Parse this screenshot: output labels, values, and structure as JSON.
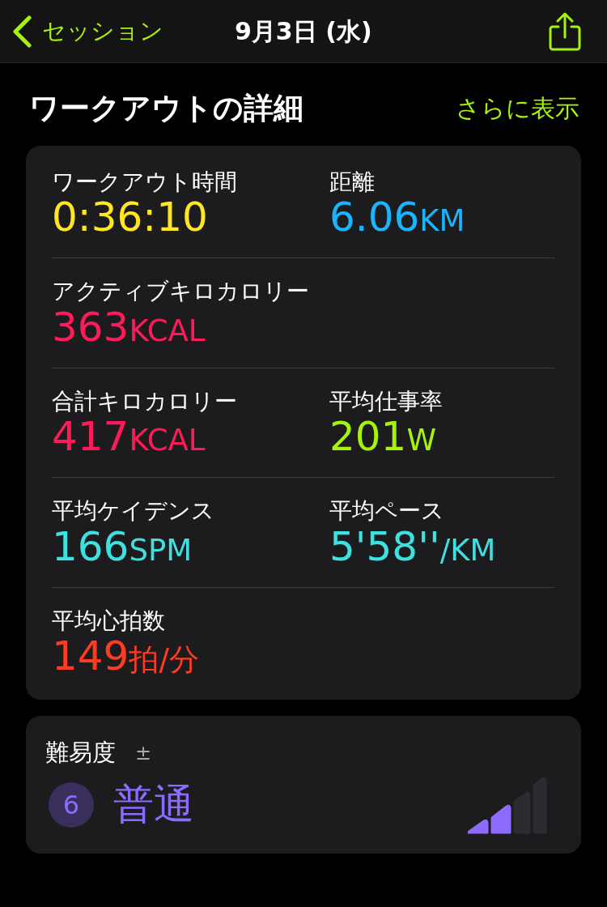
{
  "nav": {
    "back_label": "セッション",
    "title": "9月3日 (水)"
  },
  "section": {
    "title": "ワークアウトの詳細",
    "more_link": "さらに表示"
  },
  "metric_rows": [
    {
      "metrics": [
        {
          "label": "ワークアウト時間",
          "value": "0:36:10",
          "color": "#ffe620"
        },
        {
          "label": "距離",
          "value": "6.06",
          "unit": "KM",
          "color": "#1ab4ff"
        }
      ]
    },
    {
      "metrics": [
        {
          "label": "アクティブキロカロリー",
          "value": "363",
          "unit": "KCAL",
          "color": "#ff1a5a"
        }
      ]
    },
    {
      "metrics": [
        {
          "label": "合計キロカロリー",
          "value": "417",
          "unit": "KCAL",
          "color": "#ff1a5a"
        },
        {
          "label": "平均仕事率",
          "value": "201",
          "unit": "W",
          "color": "#a6f20a"
        }
      ]
    },
    {
      "metrics": [
        {
          "label": "平均ケイデンス",
          "value": "166",
          "unit": "SPM",
          "color": "#3ee0e0"
        },
        {
          "label": "平均ペース",
          "value": "5'58''",
          "unit": "/KM",
          "color": "#3ee0e0"
        }
      ]
    },
    {
      "metrics": [
        {
          "label": "平均心拍数",
          "value": "149",
          "unit": "拍/分",
          "color": "#ff3b22"
        }
      ]
    }
  ],
  "effort": {
    "label": "難易度",
    "adjust_symbol": "±",
    "score": "6",
    "rating": "普通",
    "level": 0.5
  }
}
